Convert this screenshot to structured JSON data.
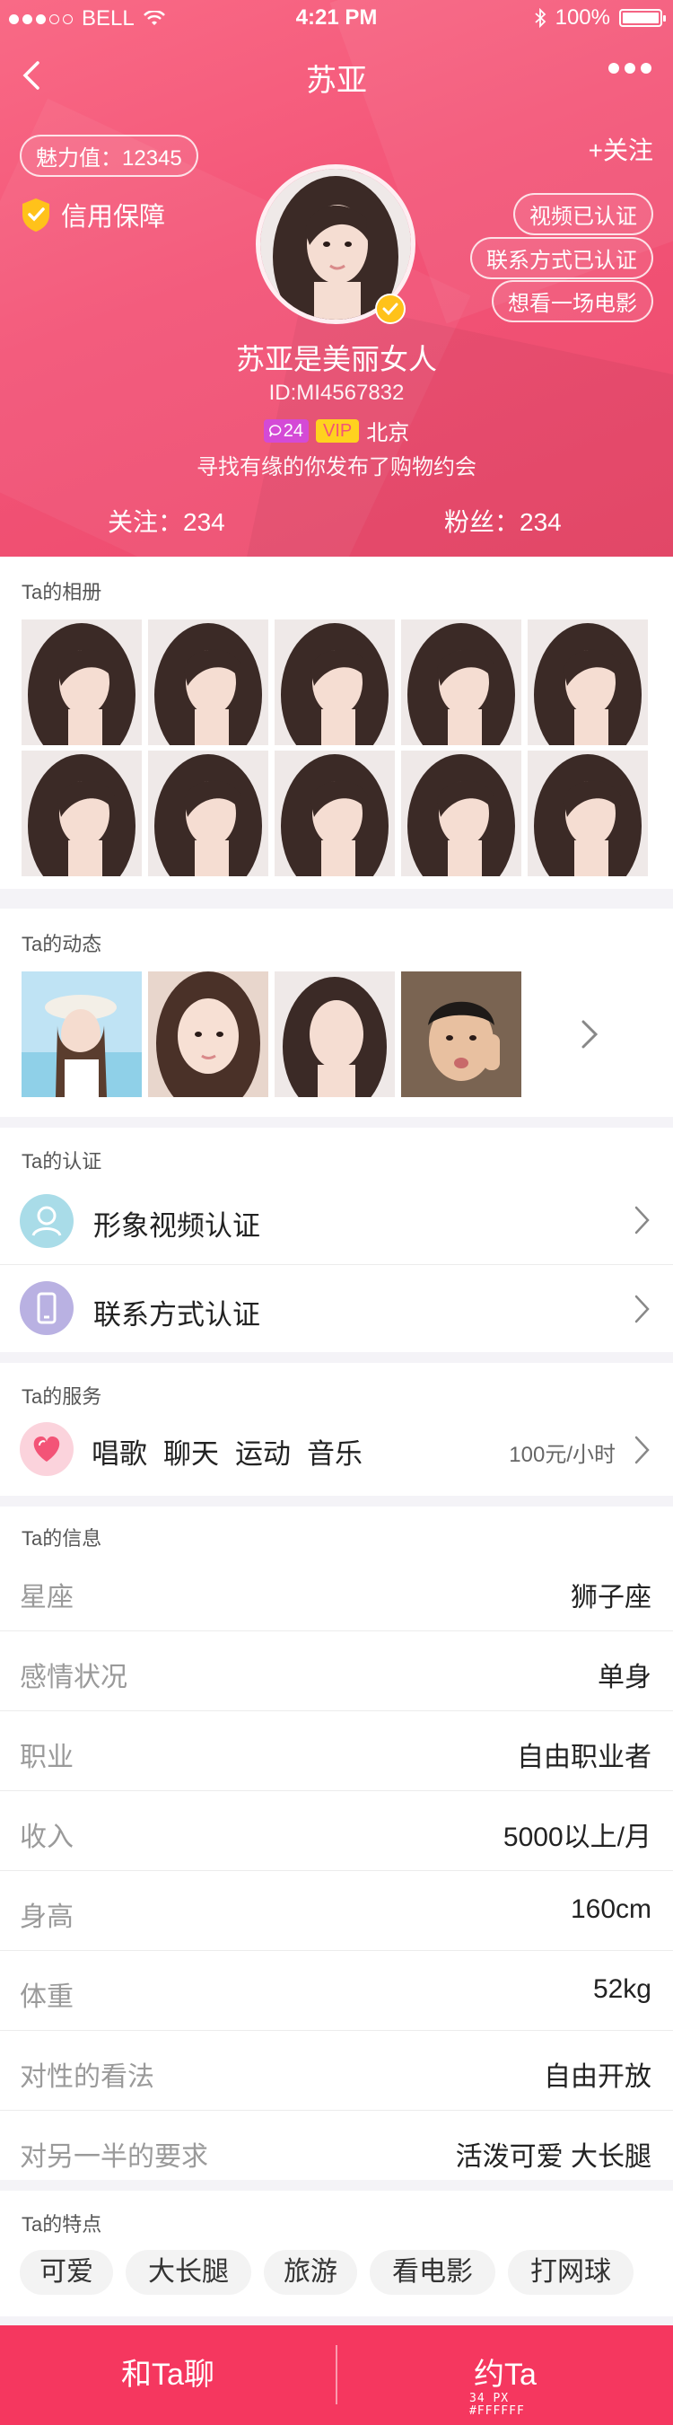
{
  "status_bar": {
    "carrier": "BELL",
    "time": "4:21 PM",
    "battery": "100%"
  },
  "nav": {
    "title": "苏亚"
  },
  "profile": {
    "charm": "魅力值：12345",
    "follow": "+关注",
    "credit": "信用保障",
    "certs": [
      "视频已认证",
      "联系方式已认证",
      "想看一场电影"
    ],
    "name": "苏亚是美丽女人",
    "id": "ID:MI4567832",
    "chat_count": "24",
    "vip": "VIP",
    "city": "北京",
    "bio": "寻找有缘的你发布了购物约会",
    "following": "关注：234",
    "fans": "粉丝：234"
  },
  "album": {
    "title": "Ta的相册"
  },
  "moments": {
    "title": "Ta的动态"
  },
  "auth": {
    "title": "Ta的认证",
    "items": [
      "形象视频认证",
      "联系方式认证"
    ]
  },
  "service": {
    "title": "Ta的服务",
    "tags": [
      "唱歌",
      "聊天",
      "运动",
      "音乐"
    ],
    "price": "100元/小时"
  },
  "info": {
    "title": "Ta的信息",
    "rows": [
      {
        "k": "星座",
        "v": "狮子座"
      },
      {
        "k": "感情状况",
        "v": "单身"
      },
      {
        "k": "职业",
        "v": "自由职业者"
      },
      {
        "k": "收入",
        "v": "5000以上/月"
      },
      {
        "k": "身高",
        "v": "160cm"
      },
      {
        "k": "体重",
        "v": "52kg"
      },
      {
        "k": "对性的看法",
        "v": "自由开放"
      },
      {
        "k": "对另一半的要求",
        "v": "活泼可爱 大长腿"
      }
    ]
  },
  "traits": {
    "title": "Ta的特点",
    "items": [
      "可爱",
      "大长腿",
      "旅游",
      "看电影",
      "打网球"
    ]
  },
  "actions": {
    "chat": "和Ta聊",
    "date": "约Ta",
    "note_size": "34 PX",
    "note_color": "#FFFFFF"
  },
  "colors": {
    "brand": "#f35477",
    "bottom_bar": "#f5375f"
  }
}
